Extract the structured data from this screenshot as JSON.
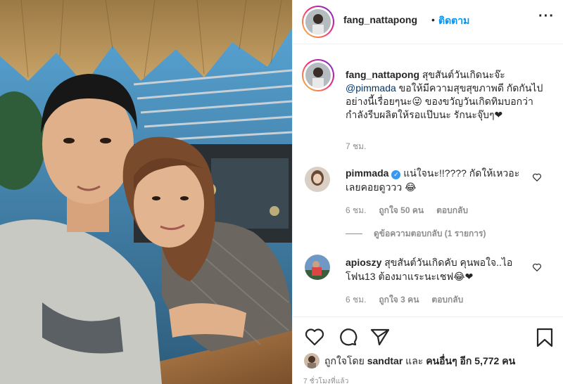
{
  "post": {
    "owner": "fang_nattapong",
    "dot": "•",
    "follow_label": "ติดตาม",
    "more_label": "···",
    "caption": {
      "username": "fang_nattapong",
      "part1": " สุขสันต์วันเกิดนะจ๊ะ ",
      "mention": "@pimmada",
      "part2": " ขอให้มีความสุขสุขภาพดี กัดกันไปอย่างนี้เรื่อยๆนะ😜 ของขวัญวันเกิดทิมบอกว่ากำลังรีบผลิตให้รอแป๊บนะ รักนะจุ๊บๆ❤",
      "time": "7 ชม."
    },
    "comments": [
      {
        "username": "pimmada",
        "verified": true,
        "verified_icon": "✓",
        "text": " แน่ใจนะ!!???? กัดให้เหวอะเลยคอยดูววว 😂",
        "time": "6 ชม.",
        "likes": "ถูกใจ 50 คน",
        "reply": "ตอบกลับ"
      },
      {
        "username": "apioszy",
        "verified": false,
        "text": " สุขสันต์วันเกิดคับ คุนพอใจ..ไอโฟน13 ต้องมาแระนะเชฟ😂❤",
        "time": "6 ชม.",
        "likes": "ถูกใจ 3 คน",
        "reply": "ตอบกลับ"
      }
    ],
    "view_replies": "ดูข้อความตอบกลับ (1 รายการ)",
    "liked_by": {
      "prefix": "ถูกใจโดย ",
      "user": "sandtar",
      "middle": " และ ",
      "others": "คนอื่นๆ อีก 5,772 คน"
    },
    "time_ago": "7 ชั่วโมงที่แล้ว",
    "icons": {
      "like": "heart-icon",
      "comment": "comment-icon",
      "share": "share-icon",
      "save": "bookmark-icon"
    }
  }
}
